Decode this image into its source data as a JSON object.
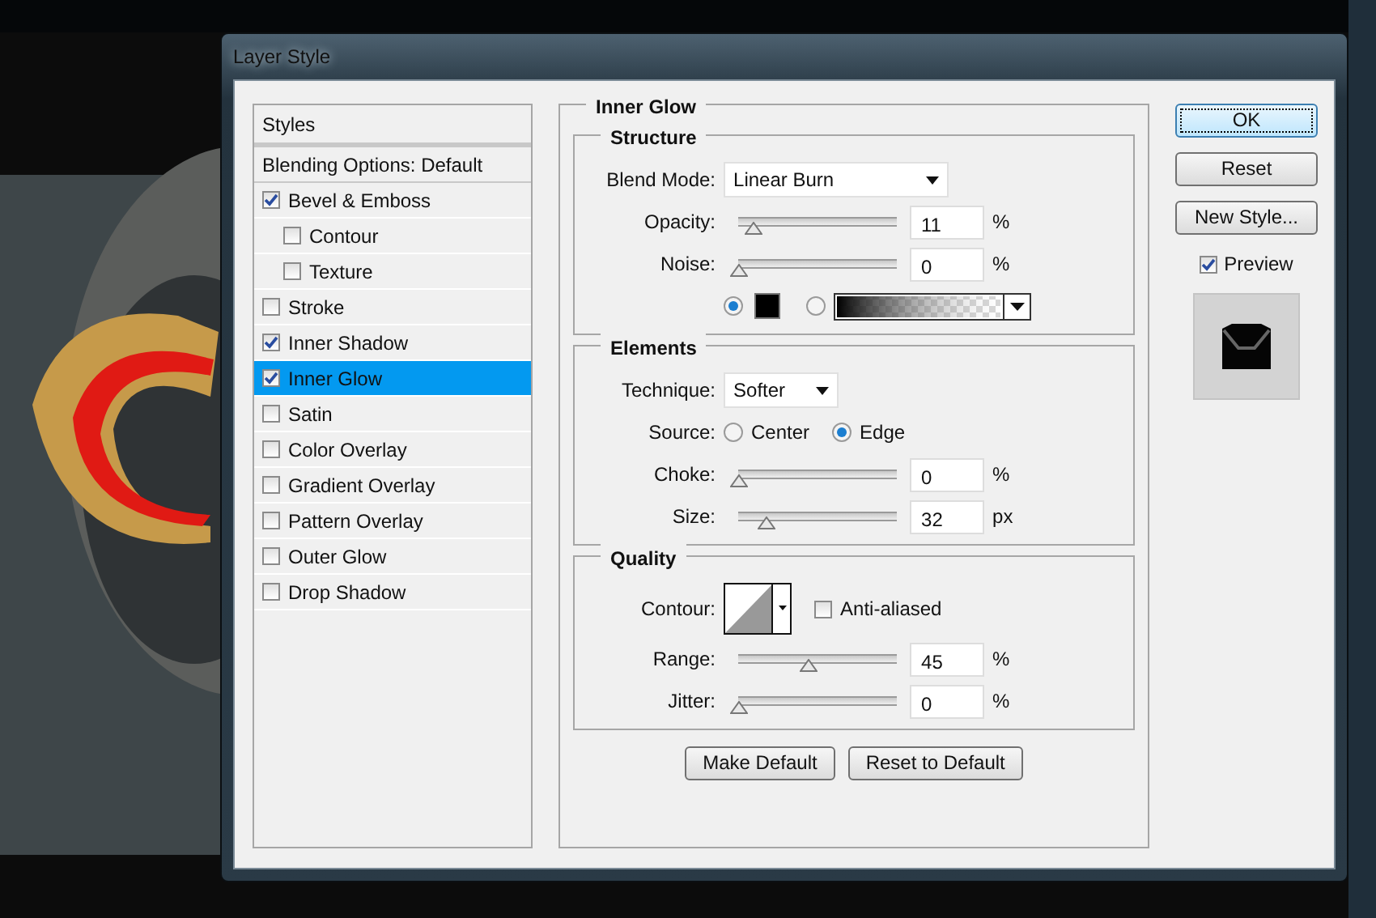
{
  "window": {
    "title": "Layer Style"
  },
  "styles_list": {
    "header": "Styles",
    "items": [
      {
        "kind": "plain",
        "label": "Blending Options: Default",
        "selected": false
      },
      {
        "kind": "check",
        "label": "Bevel & Emboss",
        "checked": true,
        "selected": false,
        "children": [
          {
            "kind": "check",
            "label": "Contour",
            "checked": false,
            "selected": false
          },
          {
            "kind": "check",
            "label": "Texture",
            "checked": false,
            "selected": false
          }
        ]
      },
      {
        "kind": "check",
        "label": "Stroke",
        "checked": false,
        "selected": false
      },
      {
        "kind": "check",
        "label": "Inner Shadow",
        "checked": true,
        "selected": false
      },
      {
        "kind": "check",
        "label": "Inner Glow",
        "checked": true,
        "selected": true
      },
      {
        "kind": "check",
        "label": "Satin",
        "checked": false,
        "selected": false
      },
      {
        "kind": "check",
        "label": "Color Overlay",
        "checked": false,
        "selected": false
      },
      {
        "kind": "check",
        "label": "Gradient Overlay",
        "checked": false,
        "selected": false
      },
      {
        "kind": "check",
        "label": "Pattern Overlay",
        "checked": false,
        "selected": false
      },
      {
        "kind": "check",
        "label": "Outer Glow",
        "checked": false,
        "selected": false
      },
      {
        "kind": "check",
        "label": "Drop Shadow",
        "checked": false,
        "selected": false
      }
    ]
  },
  "panel": {
    "title": "Inner Glow",
    "groups": [
      {
        "title": "Structure",
        "rows": [
          {
            "kind": "select",
            "label": "Blend Mode:",
            "value": "Linear Burn"
          },
          {
            "kind": "slider",
            "label": "Opacity:",
            "level": 0.09,
            "value": "11",
            "unit": "%"
          },
          {
            "kind": "slider",
            "label": "Noise:",
            "level": 0,
            "value": "0",
            "unit": "%"
          },
          {
            "kind": "fill",
            "options": [
              {
                "kind": "color",
                "selected": true
              },
              {
                "kind": "gradient",
                "selected": false
              }
            ]
          }
        ]
      },
      {
        "title": "Elements",
        "rows": [
          {
            "kind": "select",
            "label": "Technique:",
            "value": "Softer"
          },
          {
            "kind": "radios",
            "label": "Source:",
            "options": [
              {
                "label": "Center",
                "selected": false
              },
              {
                "label": "Edge",
                "selected": true
              }
            ]
          },
          {
            "kind": "slider",
            "label": "Choke:",
            "level": 0,
            "value": "0",
            "unit": "%"
          },
          {
            "kind": "slider",
            "label": "Size:",
            "level": 0.18,
            "value": "32",
            "unit": "px"
          }
        ]
      },
      {
        "title": "Quality",
        "rows": [
          {
            "kind": "contour",
            "label": "Contour:",
            "checkbox": {
              "label": "Anti-aliased",
              "checked": false
            }
          },
          {
            "kind": "slider",
            "label": "Range:",
            "level": 0.45,
            "value": "45",
            "unit": "%"
          },
          {
            "kind": "slider",
            "label": "Jitter:",
            "level": 0,
            "value": "0",
            "unit": "%"
          }
        ]
      }
    ],
    "buttons": [
      "Make Default",
      "Reset to Default"
    ]
  },
  "side": {
    "buttons": [
      {
        "label": "OK",
        "default": true
      },
      {
        "label": "Reset",
        "default": false
      },
      {
        "label": "New Style...",
        "default": false
      }
    ],
    "preview": {
      "label": "Preview",
      "checked": true
    }
  }
}
